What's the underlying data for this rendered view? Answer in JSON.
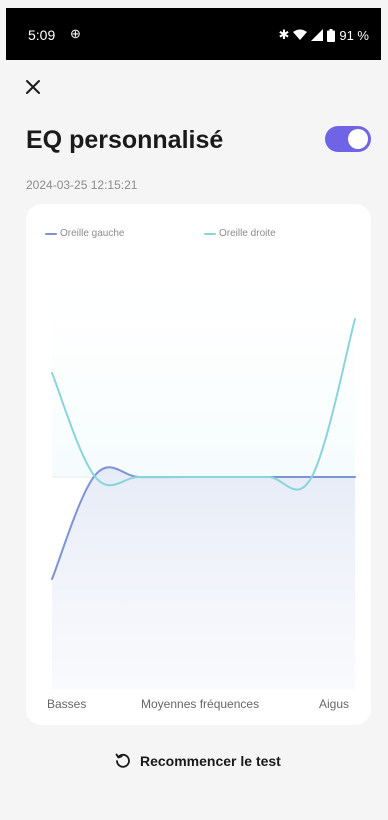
{
  "status_bar": {
    "time": "5:09",
    "battery_text": "91 %"
  },
  "header": {
    "title": "EQ personnalisé",
    "toggle_on": true
  },
  "timestamp": "2024-03-25 12:15:21",
  "colors": {
    "accent": "#7064e6",
    "left_ear": "#7e93d6",
    "right_ear": "#8ad4dc"
  },
  "chart_data": {
    "type": "line",
    "series": [
      {
        "name": "Oreille gauche",
        "values": [
          -10.2,
          0.2,
          0.0,
          0.0,
          0.0,
          0.0,
          0.0,
          0.0
        ]
      },
      {
        "name": "Oreille droite",
        "values": [
          10.4,
          0.0,
          0.0,
          0.0,
          0.0,
          0.0,
          0.0,
          15.8
        ]
      }
    ],
    "x_labels": [
      "Basses",
      "Moyennes fréquences",
      "Aigus"
    ],
    "grid": false,
    "legend": "top"
  },
  "footer": {
    "restart_label": "Recommencer le test"
  }
}
